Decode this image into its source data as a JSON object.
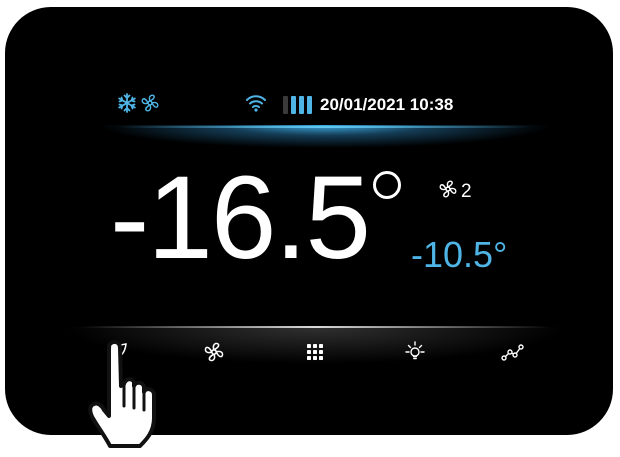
{
  "status_bar": {
    "snowflake_icon": "snowflake-icon",
    "fan_icon": "fan-icon",
    "wifi_icon": "wifi-icon",
    "battery_icon": "battery-icon",
    "datetime": "20/01/2021 10:38"
  },
  "temperature": {
    "main": "-16.5",
    "setpoint": "-10.5°",
    "fan_speed": "2"
  },
  "nav": {
    "items": [
      "leaf-icon",
      "fan-icon",
      "menu-grid-icon",
      "light-bulb-icon",
      "chart-icon"
    ]
  },
  "colors": {
    "accent": "#4fb5e6",
    "background": "#000000",
    "text": "#ffffff"
  }
}
